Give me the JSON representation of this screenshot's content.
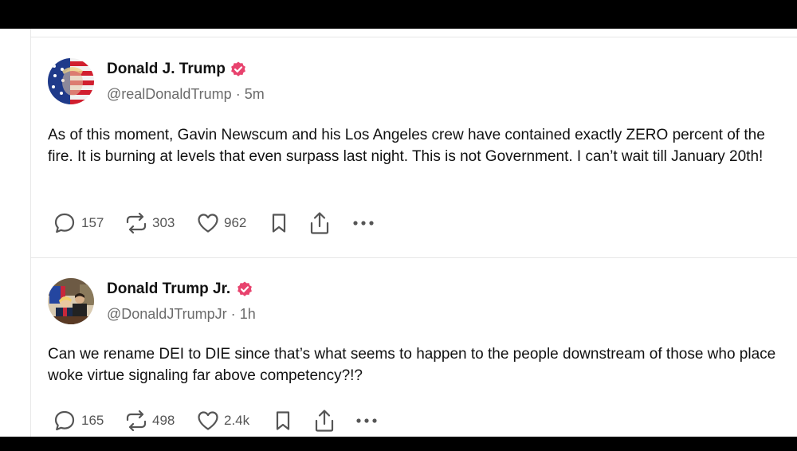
{
  "posts": [
    {
      "author": "Donald J. Trump",
      "handle": "@realDonaldTrump",
      "separator": "·",
      "time": "5m",
      "text": "As of this moment, Gavin Newscum and his Los Angeles crew have contained exactly ZERO percent of the fire. It is burning at levels that even surpass last night. This is not Government. I can’t wait till January 20th!",
      "replies": "157",
      "reposts": "303",
      "likes": "962"
    },
    {
      "author": "Donald Trump Jr.",
      "handle": "@DonaldJTrumpJr",
      "separator": "·",
      "time": "1h",
      "text": "Can we rename DEI to DIE since that’s what seems to happen to the people downstream of those who place woke virtue signaling far above competency?!?",
      "replies": "165",
      "reposts": "498",
      "likes": "2.4k"
    }
  ],
  "colors": {
    "verified_badge": "#e8436e",
    "icon": "#555555",
    "divider": "#e6e6e6"
  },
  "icons": [
    "reply-icon",
    "repost-icon",
    "like-icon",
    "bookmark-icon",
    "share-icon",
    "more-icon",
    "verified-badge-icon"
  ]
}
